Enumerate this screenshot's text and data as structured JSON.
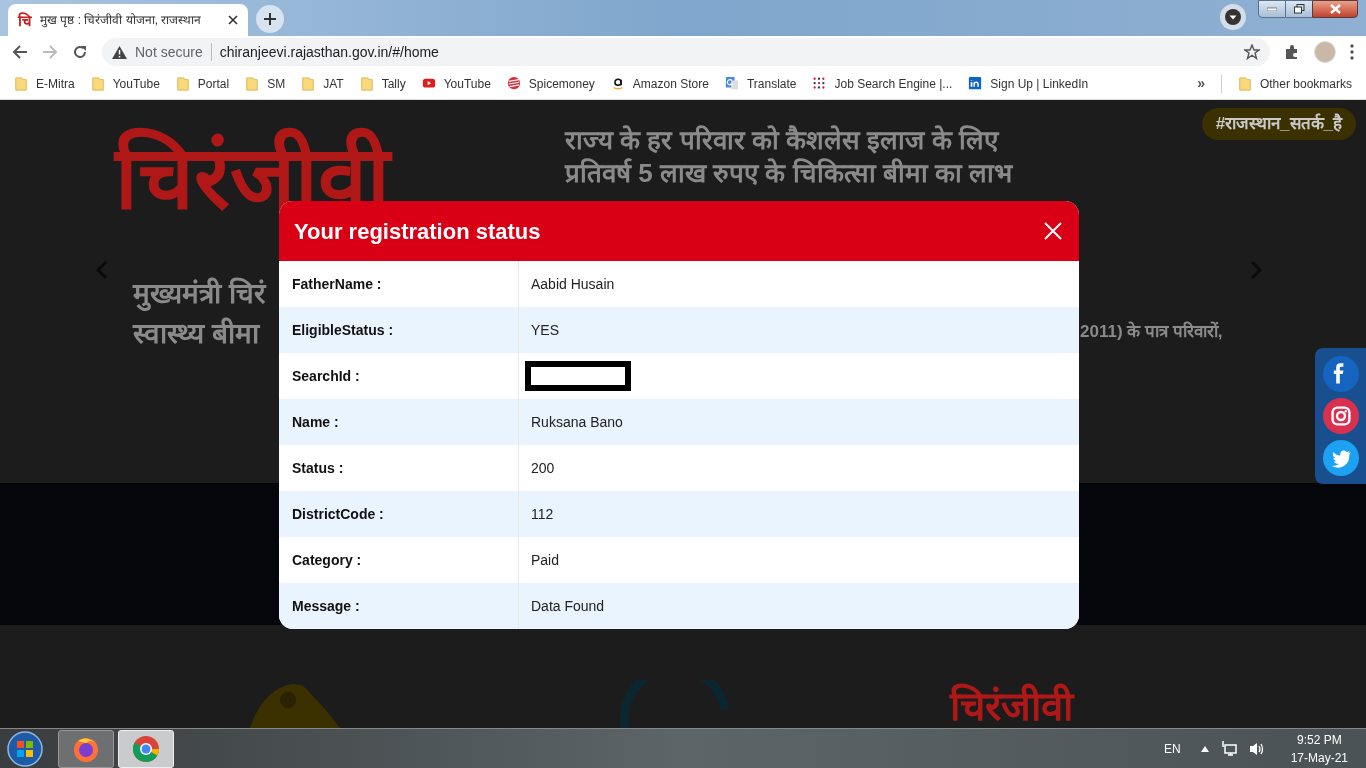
{
  "browser": {
    "tab": {
      "favicon": "चि",
      "title": "मुख पृष्ठ : चिरंजीवी योजना, राजस्थान"
    },
    "forward": {
      "disabled": true
    },
    "address": {
      "security": "Not secure",
      "url": "chiranjeevi.rajasthan.gov.in/#/home"
    },
    "bookmarks": [
      {
        "label": "E-Mitra",
        "kind": "folder"
      },
      {
        "label": "YouTube",
        "kind": "folder"
      },
      {
        "label": "Portal",
        "kind": "folder"
      },
      {
        "label": "SM",
        "kind": "folder"
      },
      {
        "label": "JAT",
        "kind": "folder"
      },
      {
        "label": "Tally",
        "kind": "folder"
      },
      {
        "label": "YouTube",
        "kind": "youtube"
      },
      {
        "label": "Spicemoney",
        "kind": "spice"
      },
      {
        "label": "Amazon Store",
        "kind": "amazon"
      },
      {
        "label": "Translate",
        "kind": "translate"
      },
      {
        "label": "Job Search Engine |...",
        "kind": "dots"
      },
      {
        "label": "Sign Up | LinkedIn",
        "kind": "linkedin"
      }
    ],
    "overflow": "»",
    "other_bookmarks": "Other bookmarks"
  },
  "page": {
    "tag": "#राजस्थान_सतर्क_है",
    "logo": "चिरंजीवी",
    "headline": [
      "राज्य के हर परिवार को कैशलेस इलाज के लिए",
      "प्रतिवर्ष 5 लाख रुपए के चिकित्सा बीमा का लाभ"
    ],
    "intro": [
      "मुख्यमंत्री चिरं",
      "स्वास्थ्य बीमा"
    ],
    "intro_right": "2011) के पात्र परिवारों,",
    "footer_logo": "चिरंजीवी",
    "social": [
      {
        "kind": "facebook"
      },
      {
        "kind": "instagram"
      },
      {
        "kind": "twitter"
      }
    ]
  },
  "modal": {
    "title": "Your registration status",
    "rows": [
      {
        "label": "FatherName :",
        "value": "Aabid Husain",
        "kind": "text"
      },
      {
        "label": "EligibleStatus :",
        "value": "YES",
        "kind": "text"
      },
      {
        "label": "SearchId :",
        "kind": "redacted"
      },
      {
        "label": "Name :",
        "value": "Ruksana Bano",
        "kind": "text"
      },
      {
        "label": "Status :",
        "value": "200",
        "kind": "text"
      },
      {
        "label": "DistrictCode :",
        "value": "112",
        "kind": "text"
      },
      {
        "label": "Category :",
        "value": "Paid",
        "kind": "text"
      },
      {
        "label": "Message :",
        "value": "Data Found",
        "kind": "text"
      }
    ]
  },
  "taskbar": {
    "apps": [
      {
        "kind": "firefox",
        "selected": false
      },
      {
        "kind": "chrome",
        "selected": true
      }
    ],
    "language": "EN",
    "time": "9:52 PM",
    "date": "17-May-21"
  }
}
